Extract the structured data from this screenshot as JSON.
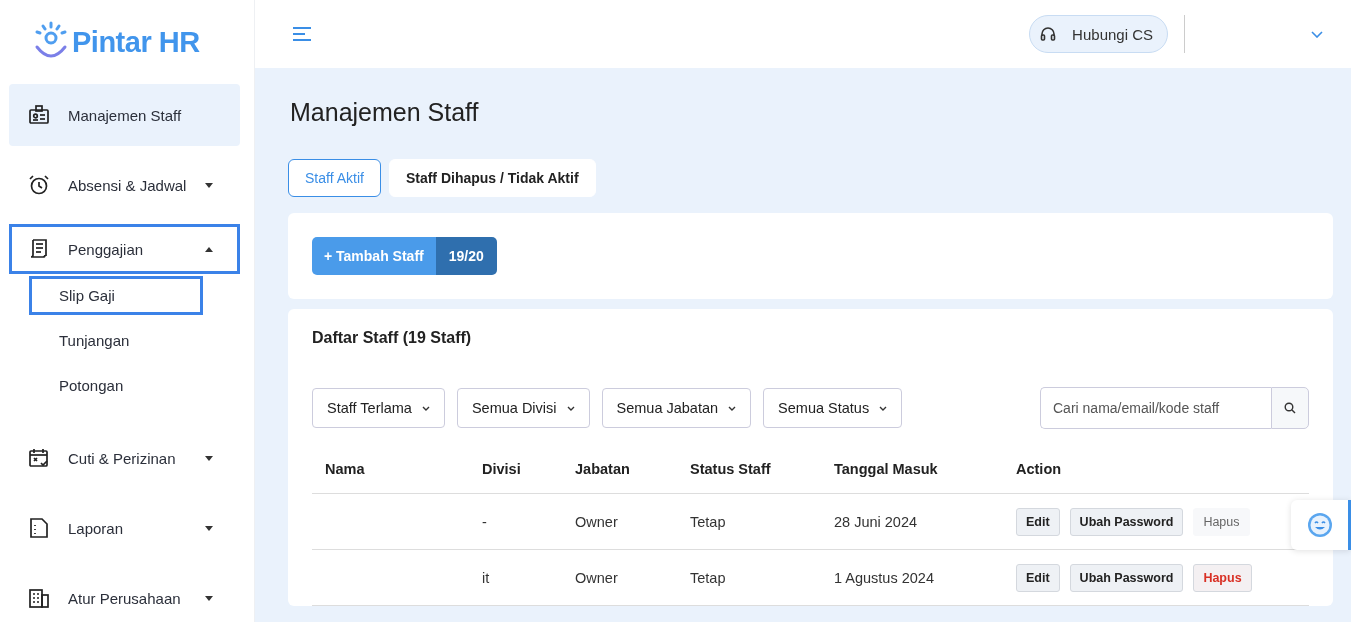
{
  "brand": {
    "name": "Pintar HR"
  },
  "sidebar": {
    "items": [
      {
        "label": "Manajemen Staff",
        "selected": true,
        "highlighted": false
      },
      {
        "label": "Absensi & Jadwal",
        "selected": false,
        "highlighted": false,
        "expanded": false
      },
      {
        "label": "Penggajian",
        "selected": false,
        "highlighted": true,
        "expanded": true,
        "children": [
          {
            "label": "Slip Gaji",
            "highlighted": true
          },
          {
            "label": "Tunjangan",
            "highlighted": false
          },
          {
            "label": "Potongan",
            "highlighted": false
          }
        ]
      },
      {
        "label": "Cuti & Perizinan",
        "selected": false,
        "highlighted": false,
        "expanded": false
      },
      {
        "label": "Laporan",
        "selected": false,
        "highlighted": false,
        "expanded": false
      },
      {
        "label": "Atur Perusahaan",
        "selected": false,
        "highlighted": false,
        "expanded": false
      }
    ]
  },
  "topbar": {
    "contact_button": "Hubungi CS"
  },
  "page": {
    "title": "Manajemen Staff",
    "tabs": [
      {
        "label": "Staff Aktif",
        "selected": true
      },
      {
        "label": "Staff Dihapus / Tidak Aktif",
        "selected": false
      }
    ],
    "add_button": {
      "label": "+ Tambah Staff",
      "count": "19/20"
    },
    "list": {
      "title": "Daftar Staff (19 Staff)",
      "filters": [
        "Staff Terlama",
        "Semua Divisi",
        "Semua Jabatan",
        "Semua Status"
      ],
      "search": {
        "placeholder": "Cari nama/email/kode staff"
      },
      "columns": [
        "Nama",
        "Divisi",
        "Jabatan",
        "Status Staff",
        "Tanggal Masuk",
        "Action"
      ],
      "rows": [
        {
          "divisi": "-",
          "jabatan": "Owner",
          "status": "Tetap",
          "tanggal": "28 Juni 2024",
          "actions": {
            "edit": "Edit",
            "password": "Ubah Password",
            "delete": "Hapus",
            "delete_disabled": true
          }
        },
        {
          "divisi": "it",
          "jabatan": "Owner",
          "status": "Tetap",
          "tanggal": "1 Agustus 2024",
          "actions": {
            "edit": "Edit",
            "password": "Ubah Password",
            "delete": "Hapus",
            "delete_disabled": false
          }
        }
      ]
    }
  }
}
